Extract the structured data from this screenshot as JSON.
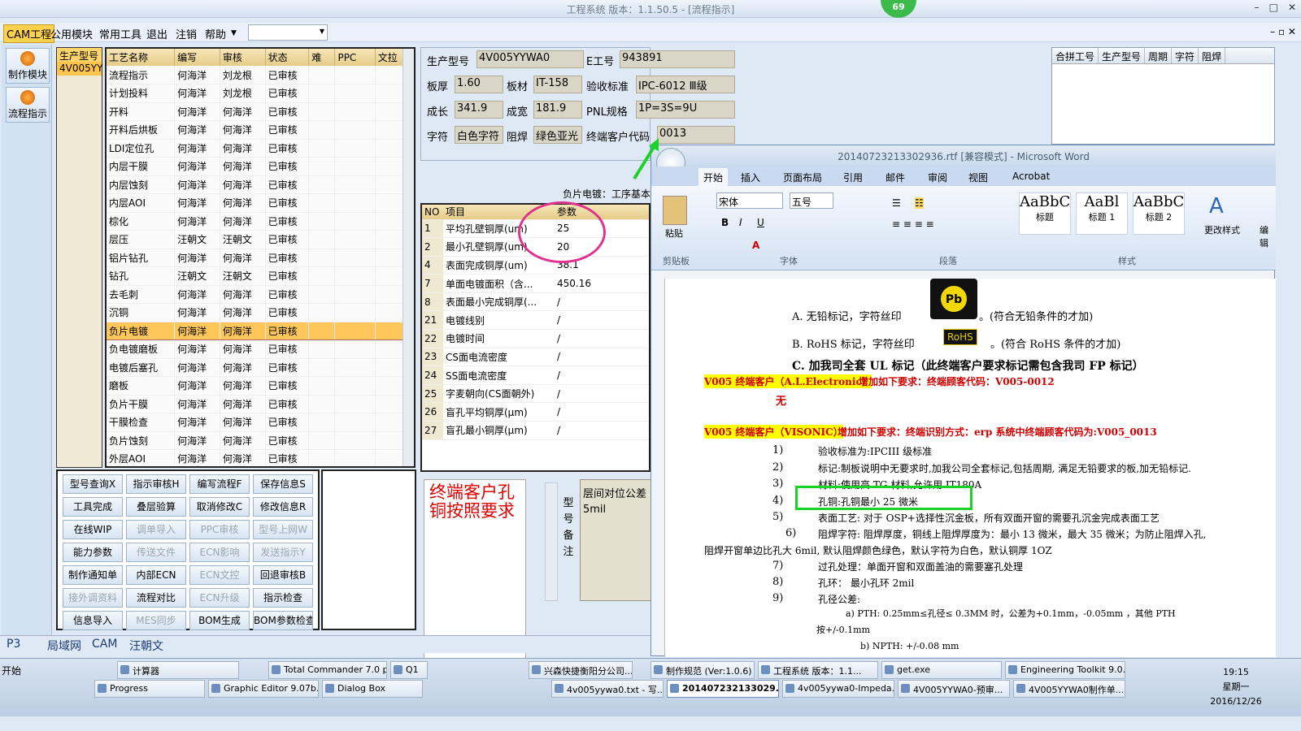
{
  "app": {
    "title": "工程系统  版本：1.1.50.5 - [流程指示]",
    "badge": "69"
  },
  "menu": {
    "cam": "CAM工程",
    "items": [
      "公用模块",
      "常用工具",
      "退出",
      "注销",
      "帮助"
    ]
  },
  "modules": [
    "制作模块",
    "流程指示"
  ],
  "small_grid": {
    "header": "生产型号",
    "value": "4V005YY"
  },
  "process": {
    "columns": [
      "工艺名称",
      "编写",
      "审核",
      "状态",
      "难",
      "PPC",
      "文拉"
    ],
    "rows": [
      [
        "流程指示",
        "何海洋",
        "刘龙根",
        "已审核"
      ],
      [
        "计划投料",
        "何海洋",
        "刘龙根",
        "已审核"
      ],
      [
        "开料",
        "何海洋",
        "何海洋",
        "已审核"
      ],
      [
        "开料后烘板",
        "何海洋",
        "何海洋",
        "已审核"
      ],
      [
        "LDI定位孔",
        "何海洋",
        "何海洋",
        "已审核"
      ],
      [
        "内层干膜",
        "何海洋",
        "何海洋",
        "已审核"
      ],
      [
        "内层蚀刻",
        "何海洋",
        "何海洋",
        "已审核"
      ],
      [
        "内层AOI",
        "何海洋",
        "何海洋",
        "已审核"
      ],
      [
        "棕化",
        "何海洋",
        "何海洋",
        "已审核"
      ],
      [
        "层压",
        "汪朝文",
        "汪朝文",
        "已审核"
      ],
      [
        "铝片钻孔",
        "何海洋",
        "何海洋",
        "已审核"
      ],
      [
        "钻孔",
        "汪朝文",
        "汪朝文",
        "已审核"
      ],
      [
        "去毛刺",
        "何海洋",
        "何海洋",
        "已审核"
      ],
      [
        "沉铜",
        "何海洋",
        "何海洋",
        "已审核"
      ],
      [
        "负片电镀",
        "何海洋",
        "何海洋",
        "已审核"
      ],
      [
        "负电镀磨板",
        "何海洋",
        "何海洋",
        "已审核"
      ],
      [
        "电镀后塞孔",
        "何海洋",
        "何海洋",
        "已审核"
      ],
      [
        "磨板",
        "何海洋",
        "何海洋",
        "已审核"
      ],
      [
        "负片干膜",
        "何海洋",
        "何海洋",
        "已审核"
      ],
      [
        "干膜检查",
        "何海洋",
        "何海洋",
        "已审核"
      ],
      [
        "负片蚀刻",
        "何海洋",
        "何海洋",
        "已审核"
      ],
      [
        "外层AOI",
        "何海洋",
        "何海洋",
        "已审核"
      ]
    ],
    "selected_index": 14
  },
  "buttons": [
    [
      "型号查询X",
      "指示审核H",
      "编写流程F",
      "保存信息S"
    ],
    [
      "工具完成",
      "叠层验算",
      "取消修改C",
      "修改信息R"
    ],
    [
      "在线WIP",
      "调单导入",
      "PPC审核",
      "型号上网W"
    ],
    [
      "能力参数",
      "传送文件",
      "ECN影响",
      "发送指示Y"
    ],
    [
      "制作通知单",
      "内部ECN",
      "ECN文控",
      "回退审核B"
    ],
    [
      "接外调资料",
      "流程对比",
      "ECN升级",
      "指示检查"
    ],
    [
      "信息导入",
      "MES同步",
      "BOM生成",
      "BOM参数检查"
    ]
  ],
  "disabled_buttons": [
    "调单导入",
    "PPC审核",
    "型号上网W",
    "传送文件",
    "ECN影响",
    "发送指示Y",
    "ECN文控",
    "接外调资料",
    "ECN升级",
    "MES同步"
  ],
  "info": {
    "model_label": "生产型号",
    "model": "4V005YYWA0",
    "e_label": "E工号",
    "e_no": "943891",
    "thick_label": "板厚",
    "thick": "1.60",
    "mat_label": "板材",
    "mat": "IT-158",
    "std_label": "验收标准",
    "std": "IPC-6012 Ⅲ级",
    "len_label": "成长",
    "len": "341.9",
    "wid_label": "成宽",
    "wid": "181.9",
    "pnl_label": "PNL规格",
    "pnl": "1P=3S=9U",
    "char_label": "字符",
    "char": "白色字符",
    "mask_label": "阻焊",
    "mask": "绿色亚光",
    "cust_label": "终端客户代码",
    "cust": "0013"
  },
  "elec": {
    "header": "负片电镀：工序基本",
    "cols": [
      "NO",
      "项目",
      "参数"
    ],
    "rows": [
      [
        "1",
        "平均孔壁铜厚(um)",
        "25"
      ],
      [
        "2",
        "最小孔壁铜厚(um)",
        "20"
      ],
      [
        "4",
        "表面完成铜厚(um)",
        "38.1"
      ],
      [
        "7",
        "单面电镀面积（含...",
        "450.16"
      ],
      [
        "8",
        "表面最小完成铜厚(...",
        "/"
      ],
      [
        "21",
        "电镀线别",
        "/"
      ],
      [
        "22",
        "电镀时间",
        "/"
      ],
      [
        "23",
        "CS面电流密度",
        "/"
      ],
      [
        "24",
        "SS面电流密度",
        "/"
      ],
      [
        "25",
        "字麦朝向(CS面朝外)",
        "/"
      ],
      [
        "26",
        "盲孔平均铜厚(μm)",
        "/"
      ],
      [
        "27",
        "盲孔最小铜厚(μm)",
        "/"
      ]
    ]
  },
  "remark": {
    "side": "型号备注",
    "header": "层间对位公差",
    "value": "5mil"
  },
  "note": "终端客户孔铜按照要求",
  "right_panel": {
    "cols": [
      "合拼工号",
      "生产型号",
      "周期",
      "字符",
      "阻焊"
    ]
  },
  "word": {
    "title": "20140723213302936.rtf [兼容模式] - Microsoft Word",
    "tabs": [
      "开始",
      "插入",
      "页面布局",
      "引用",
      "邮件",
      "审阅",
      "视图",
      "Acrobat"
    ],
    "font": "宋体",
    "size": "五号",
    "groups": [
      "剪贴板",
      "字体",
      "段落",
      "样式"
    ],
    "styles": [
      [
        "AaBbC",
        "标题"
      ],
      [
        "AaBl",
        "标题 1"
      ],
      [
        "AaBbC",
        "标题 2"
      ]
    ],
    "paste": "粘贴",
    "change_style": "更改样式",
    "edit": "编辑",
    "lines": {
      "a": "A. 无铅标记，字符丝印",
      "a2": "。(符合无铅条件的才加)",
      "b": "B. RoHS 标记，字符丝印",
      "b2": "。(符合 RoHS 条件的才加)",
      "rohs": "RoHS",
      "c": "C. 加我司全套 UL 标记（此终端客户要求标记需包含我司 FP 标记）",
      "v1a": "V005 终端客户（A.L.Electronic）",
      "v1b": "增加如下要求：终端顾客代码：V005-0012",
      "none": "无",
      "v2a": "V005 终端客户（VISONIC）",
      "v2b": "增加如下要求：终端识别方式：erp 系统中终端顾客代码为:V005_0013",
      "l1n": "1)",
      "l1": "验收标准为:IPCIII 级标准",
      "l2n": "2)",
      "l2": "标记:制板说明中无要求时,加我公司全套标记,包括周期, 满足无铅要求的板,加无铅标记.",
      "l3n": "3)",
      "l3": "材料:使用高 TG 材料,允许用 IT180A",
      "l4n": "4)",
      "l4": "孔铜:孔铜最小 25 微米",
      "l5n": "5)",
      "l5": "表面工艺: 对于 OSP+选择性沉金板，所有双面开窗的需要孔沉金完成表面工艺",
      "l6n": "6)",
      "l6": "阻焊字符: 阻焊厚度，铜线上阻焊厚度为：最小 13 微米，最大 35 微米；为防止阻焊入孔,",
      "l6b": "阻焊开窗单边比孔大 6mil, 默认阻焊颜色绿色，默认字符为白色，默认铜厚 1OZ",
      "l7n": "7)",
      "l7": "过孔处理：单面开窗和双面盖油的需要塞孔处理",
      "l8n": "8)",
      "l8": "孔环： 最小孔环 2mil",
      "l9n": "9)",
      "l9": "孔径公差:",
      "la": "a)  PTH:  0.25mm≤孔径≤ 0.3MM 时，公差为+0.1mm，-0.05mm ，其他 PTH",
      "la2": "按+/-0.1mm",
      "lb": "b)  NPTH:  +/-0.08 mm"
    }
  },
  "bottom_tabs": [
    "P3",
    "局域网",
    "CAM",
    "汪朝文"
  ],
  "taskbar": {
    "start": "开始",
    "row1": [
      "计算器",
      "Total Commander 7.0 p...",
      "Q1",
      "兴森快捷衡阳分公司...",
      "制作规范 (Ver:1.0.6)",
      "工程系统 版本：1.1...",
      "get.exe",
      "Engineering Toolkit 9.0..."
    ],
    "row2": [
      "Progress",
      "Graphic Editor 9.07b...",
      "Dialog Box",
      "4v005yywa0.txt - 写...",
      "201407232133029...",
      "4v005yywa0-Impeda...",
      "4V005YYWA0-预审...",
      "4V005YYWA0制作单..."
    ],
    "time": "19:15",
    "weekday": "星期一",
    "date": "2016/12/26"
  }
}
